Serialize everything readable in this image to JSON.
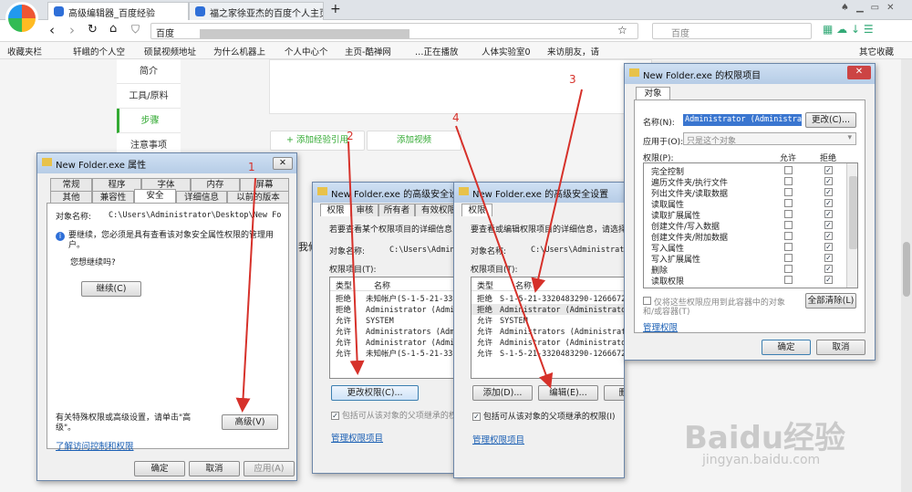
{
  "browser": {
    "tabs": [
      "高级编辑器_百度经验",
      "福之家徐亚杰的百度个人主页"
    ],
    "new_tab": "+",
    "address_prefix": "百度",
    "search_placeholder": "百度",
    "bookmarks": [
      "收藏夹栏",
      "轩峨的个人空",
      "硕鼠视频地址",
      "为什么机器上",
      "个人中心个",
      "主页-酷禅网",
      "…正在播放",
      "人体实验室0",
      "来访朋友，请"
    ],
    "other_bookmarks": "其它收藏"
  },
  "page": {
    "sidebar": [
      "简介",
      "工具/原料",
      "步骤",
      "注意事项"
    ],
    "add_ref": "+ 添加经验引用",
    "add_video": "添加视频",
    "partial_text": "我修",
    "watermark": "Baidu经验",
    "watermark_url": "jingyan.baidu.com",
    "annotations": [
      "1",
      "2",
      "3",
      "4"
    ]
  },
  "props": {
    "title": "New Folder.exe 属性",
    "tabs_row1": [
      "常规",
      "程序",
      "字体",
      "内存",
      "屏幕"
    ],
    "tabs_row2": [
      "其他",
      "兼容性",
      "安全",
      "详细信息",
      "以前的版本"
    ],
    "object_label": "对象名称:",
    "object_value": "C:\\Users\\Administrator\\Desktop\\New Folder.e",
    "info": "要继续，您必须是具有查看该对象安全属性权限的管理用户。",
    "continue_q": "您想继续吗?",
    "continue_btn": "继续(C)",
    "adv_text": "有关特殊权限或高级设置，请单击\"高级\"。",
    "adv_btn": "高级(V)",
    "link": "了解访问控制和权限",
    "ok": "确定",
    "cancel": "取消",
    "apply": "应用(A)"
  },
  "adv1": {
    "title": "New Folder.exe 的高级安全设置",
    "tabs": [
      "权限",
      "审核",
      "所有者",
      "有效权限"
    ],
    "desc": "若要查看某个权限项目的详细信息",
    "object_label": "对象名称:",
    "object_value": "C:\\Users\\Administ",
    "perm_label": "权限项目(T):",
    "col_type": "类型",
    "col_name": "名称",
    "rows": [
      [
        "拒绝",
        "未知帐户(S-1-5-21-33"
      ],
      [
        "拒绝",
        "Administrator (Admin"
      ],
      [
        "允许",
        "SYSTEM"
      ],
      [
        "允许",
        "Administrators (Admi"
      ],
      [
        "允许",
        "Administrator (Admin"
      ],
      [
        "允许",
        "未知帐户(S-1-5-21-33"
      ]
    ],
    "change_btn": "更改权限(C)...",
    "inherit": "包括可从该对象的父项继承的权",
    "link": "管理权限项目"
  },
  "adv2": {
    "title": "New Folder.exe 的高级安全设置",
    "tabs": [
      "权限"
    ],
    "desc": "要查看或编辑权限项目的详细信息，请选择",
    "object_label": "对象名称:",
    "object_value": "C:\\Users\\Administrator\\De",
    "perm_label": "权限项目(T):",
    "col_type": "类型",
    "col_name": "名称",
    "rows": [
      [
        "拒绝",
        "S-1-5-21-3320483290-1266672"
      ],
      [
        "拒绝",
        "Administrator (Administrato"
      ],
      [
        "允许",
        "SYSTEM"
      ],
      [
        "允许",
        "Administrators (Administrat"
      ],
      [
        "允许",
        "Administrator (Administrato"
      ],
      [
        "允许",
        "S-1-5-21-3320483290-1266672"
      ]
    ],
    "add_btn": "添加(D)...",
    "edit_btn": "编辑(E)...",
    "del_btn": "删除(R)",
    "inherit": "包括可从该对象的父项继承的权限(I)",
    "link": "管理权限项目"
  },
  "perm": {
    "title": "New Folder.exe 的权限项目",
    "tab": "对象",
    "name_label": "名称(N):",
    "name_value": "Administrator (Administrator-PC\\Administrator)",
    "change_btn": "更改(C)...",
    "apply_label": "应用于(O):",
    "apply_value": "只是这个对象",
    "perm_label": "权限(P):",
    "col_allow": "允许",
    "col_deny": "拒绝",
    "items": [
      "完全控制",
      "遍历文件夹/执行文件",
      "列出文件夹/读取数据",
      "读取属性",
      "读取扩展属性",
      "创建文件/写入数据",
      "创建文件夹/附加数据",
      "写入属性",
      "写入扩展属性",
      "删除",
      "读取权限"
    ],
    "only_apply": "仅将这些权限应用到此容器中的对象和/或容器(T)",
    "clear_btn": "全部清除(L)",
    "link": "管理权限",
    "ok": "确定",
    "cancel": "取消"
  }
}
